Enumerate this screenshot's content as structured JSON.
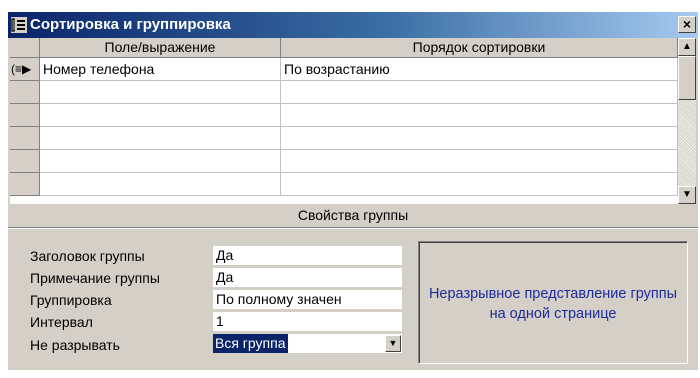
{
  "window": {
    "title": "Сортировка и группировка",
    "close_glyph": "×",
    "icon": "sorting-grouping-icon"
  },
  "grid": {
    "columns": [
      "Поле/выражение",
      "Порядок сортировки"
    ],
    "current_row_indicator": "(≡▶",
    "rows": [
      {
        "field": "Номер телефона",
        "order": "По возрастанию"
      },
      {
        "field": "",
        "order": ""
      },
      {
        "field": "",
        "order": ""
      },
      {
        "field": "",
        "order": ""
      },
      {
        "field": "",
        "order": ""
      },
      {
        "field": "",
        "order": ""
      }
    ]
  },
  "scrollbar": {
    "up_glyph": "▲",
    "down_glyph": "▼"
  },
  "group_properties": {
    "title": "Свойства группы",
    "items": [
      {
        "label": "Заголовок группы",
        "value": "Да"
      },
      {
        "label": "Примечание группы",
        "value": "Да"
      },
      {
        "label": "Группировка",
        "value": "По полному значен"
      },
      {
        "label": "Интервал",
        "value": "1"
      },
      {
        "label": "Не разрывать",
        "value": "Вся группа"
      }
    ],
    "dropdown_glyph": "▼",
    "help_text": "Неразрывное представление группы на одной странице"
  },
  "colors": {
    "title_bar_start": "#0a246a",
    "title_bar_end": "#a6caf0",
    "face": "#d4d0c8",
    "help_text": "#1f2a9c"
  }
}
